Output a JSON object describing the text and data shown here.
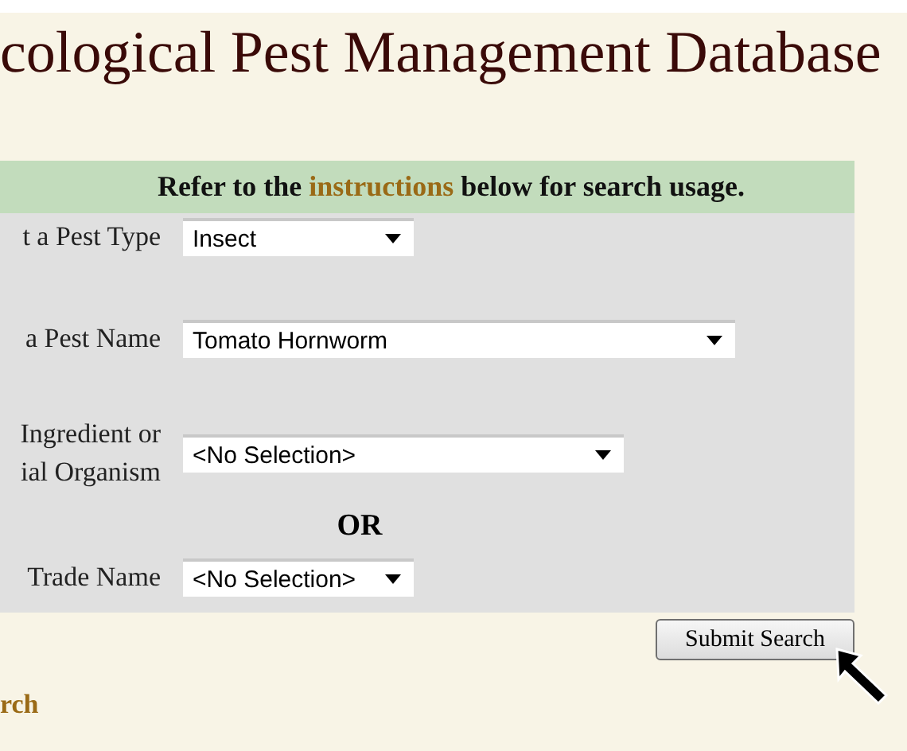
{
  "page_title": "cological Pest Management Database",
  "search_panel": {
    "notice": {
      "before": "Refer to the",
      "link": "instructions",
      "after": "below for search usage."
    },
    "rows": [
      {
        "kind": "select",
        "label": "t a Pest Type",
        "value": "Insect"
      },
      {
        "kind": "select",
        "label": "a Pest Name",
        "value": "Tomato Hornworm"
      },
      {
        "kind": "select",
        "label": "Ingredient or\nial Organism",
        "value": "<No Selection>"
      },
      {
        "kind": "or",
        "text": "OR"
      },
      {
        "kind": "select",
        "label": "Trade Name",
        "value": "<No Selection>"
      }
    ]
  },
  "submit_button": "Submit Search",
  "footer_link": "rch"
}
